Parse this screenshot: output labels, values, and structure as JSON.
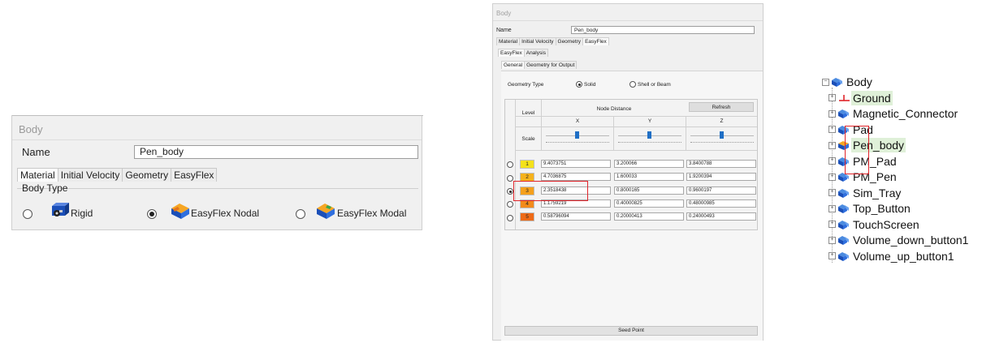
{
  "panel_a": {
    "title": "Body",
    "name_label": "Name",
    "name_value": "Pen_body",
    "tabs": [
      "Material",
      "Initial Velocity",
      "Geometry",
      "EasyFlex"
    ],
    "body_type_label": "Body Type",
    "options": [
      {
        "label": "Rigid",
        "selected": false
      },
      {
        "label": "EasyFlex Nodal",
        "selected": true
      },
      {
        "label": "EasyFlex Modal",
        "selected": false
      }
    ]
  },
  "panel_b": {
    "title": "Body",
    "name_label": "Name",
    "name_value": "Pen_body",
    "tabs_top": [
      "Material",
      "Initial Velocity",
      "Geometry",
      "EasyFlex"
    ],
    "tabs_mid": [
      "EasyFlex",
      "Analysis"
    ],
    "tabs_sub": [
      "General",
      "Geometry for Output"
    ],
    "geometry_type_label": "Geometry Type",
    "geometry_options": [
      {
        "label": "Solid",
        "selected": true
      },
      {
        "label": "Shell or Beam",
        "selected": false
      }
    ],
    "table": {
      "level_header": "Level",
      "node_distance_header": "Node Distance",
      "refresh_label": "Refresh",
      "axis_headers": [
        "X",
        "Y",
        "Z"
      ],
      "scale_label": "Scale",
      "rows": [
        {
          "level": "1",
          "x": "9.4073751",
          "y": "3.200066",
          "z": "3.8400788",
          "selected": false,
          "color": "#f4e21a"
        },
        {
          "level": "2",
          "x": "4.7036875",
          "y": "1.600033",
          "z": "1.9200394",
          "selected": false,
          "color": "#f5b21c"
        },
        {
          "level": "3",
          "x": "2.3518438",
          "y": "0.8000165",
          "z": "0.9600197",
          "selected": true,
          "color": "#f5a01c"
        },
        {
          "level": "4",
          "x": "1.1759219",
          "y": "0.40000825",
          "z": "0.48000985",
          "selected": false,
          "color": "#f28a1b"
        },
        {
          "level": "5",
          "x": "0.58796094",
          "y": "0.20000413",
          "z": "0.24000493",
          "selected": false,
          "color": "#ee6a16"
        }
      ]
    },
    "seed_point_label": "Seed Point"
  },
  "tree": {
    "root": "Body",
    "items": [
      {
        "label": "Ground",
        "icon": "ground-icon",
        "highlight": true
      },
      {
        "label": "Magnetic_Connector",
        "icon": "body-group-icon",
        "highlight": false
      },
      {
        "label": "Pad",
        "icon": "body-group-icon",
        "highlight": false
      },
      {
        "label": "Pen_body",
        "icon": "flex-body-icon",
        "highlight": true
      },
      {
        "label": "PM_Pad",
        "icon": "body-group-icon",
        "highlight": false
      },
      {
        "label": "PM_Pen",
        "icon": "body-group-icon",
        "highlight": false
      },
      {
        "label": "Sim_Tray",
        "icon": "body-group-icon",
        "highlight": false
      },
      {
        "label": "Top_Button",
        "icon": "body-group-icon",
        "highlight": false
      },
      {
        "label": "TouchScreen",
        "icon": "body-group-icon",
        "highlight": false
      },
      {
        "label": "Volume_down_button1",
        "icon": "body-group-icon",
        "highlight": false
      },
      {
        "label": "Volume_up_button1",
        "icon": "body-group-icon",
        "highlight": false
      }
    ]
  }
}
